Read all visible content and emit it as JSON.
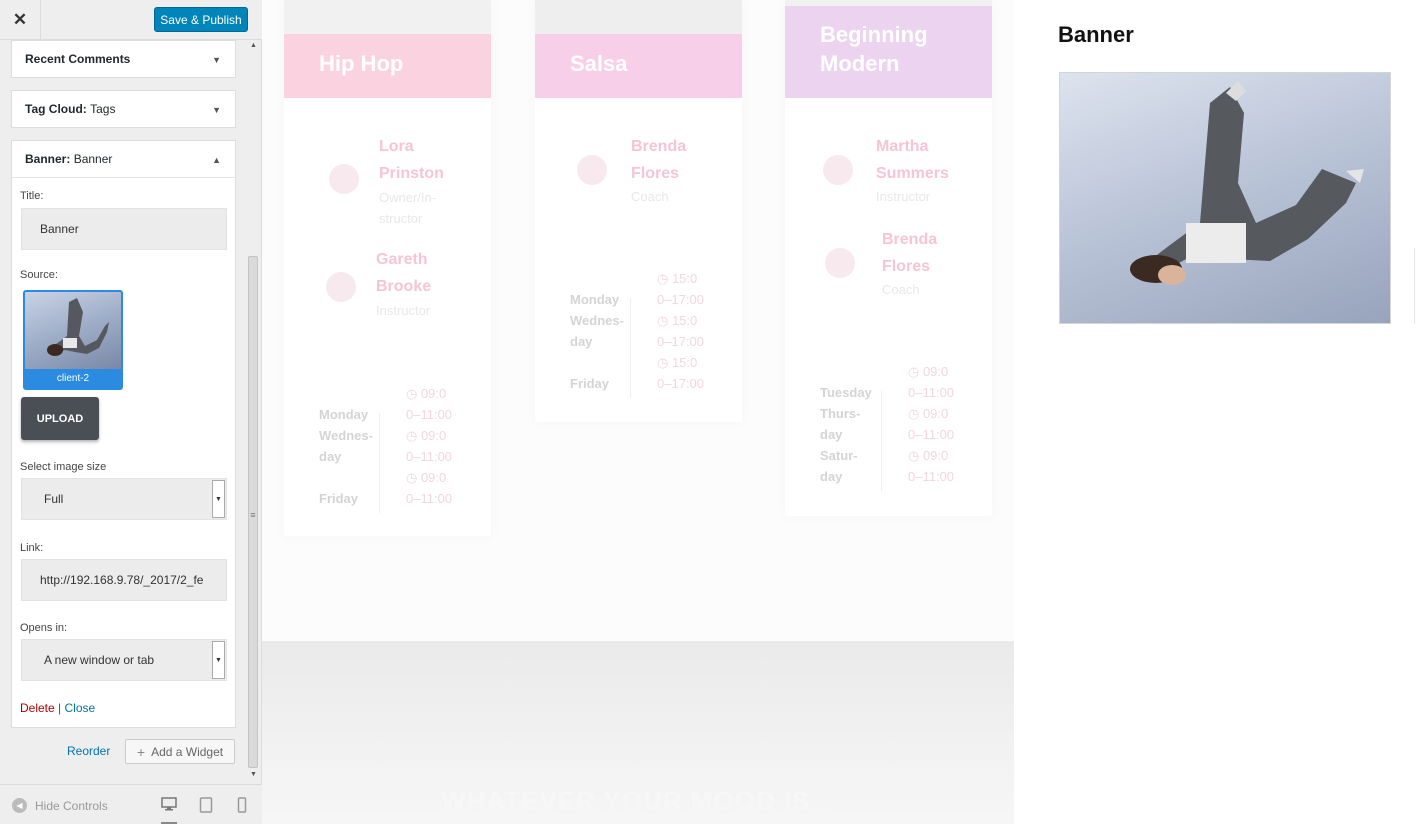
{
  "topbar": {
    "close_icon": "close-icon",
    "save_label": "Save & Publish"
  },
  "panels": {
    "recent_comments": "Recent Comments",
    "tag_cloud_name": "Tag Cloud:",
    "tag_cloud_title": "Tags",
    "banner_name": "Banner:",
    "banner_title": "Banner"
  },
  "widget": {
    "title_label": "Title:",
    "title_value": "Banner",
    "source_label": "Source:",
    "thumb_caption": "client-2",
    "upload_label": "UPLOAD",
    "size_label": "Select image size",
    "size_value": "Full",
    "link_label": "Link:",
    "link_value": "http://192.168.9.78/_2017/2_fe",
    "opens_label": "Opens in:",
    "opens_value": "A new window or tab",
    "delete_label": "Delete",
    "separator": "|",
    "close_label": "Close"
  },
  "footer": {
    "reorder_label": "Reorder",
    "add_widget_label": "Add a Widget",
    "hide_controls_label": "Hide Controls"
  },
  "preview": {
    "classes": [
      {
        "title_lines": [
          "Hip Hop"
        ],
        "instructors": [
          {
            "name_lines": [
              "Lora",
              "Prinston"
            ],
            "role_lines": [
              "Owner/In-",
              "structor"
            ]
          },
          {
            "name_lines": [
              "Gareth",
              "Brooke"
            ],
            "role_lines": [
              "Instructor"
            ]
          }
        ],
        "days": [
          "Monday",
          "Wednes-",
          "day",
          "",
          "Friday"
        ],
        "times": [
          "◷ 09:0",
          "0–11:00",
          "◷ 09:0",
          "0–11:00",
          "◷ 09:0",
          "0–11:00"
        ]
      },
      {
        "title_lines": [
          "Salsa"
        ],
        "instructors": [
          {
            "name_lines": [
              "Brenda",
              "Flores"
            ],
            "role_lines": [
              "Coach"
            ]
          }
        ],
        "days": [
          "Monday",
          "Wednes-",
          "day",
          "",
          "Friday"
        ],
        "times": [
          "◷ 15:0",
          "0–17:00",
          "◷ 15:0",
          "0–17:00",
          "◷ 15:0",
          "0–17:00"
        ]
      },
      {
        "title_lines": [
          "Beginning",
          "Modern"
        ],
        "instructors": [
          {
            "name_lines": [
              "Martha",
              "Summers"
            ],
            "role_lines": [
              "Instructor"
            ]
          },
          {
            "name_lines": [
              "Brenda",
              "Flores"
            ],
            "role_lines": [
              "Coach"
            ]
          }
        ],
        "days": [
          "Tuesday",
          "Thurs-",
          "day",
          "Satur-",
          "day"
        ],
        "times": [
          "◷ 09:0",
          "0–11:00",
          "◷ 09:0",
          "0–11:00",
          "◷ 09:0",
          "0–11:00"
        ]
      }
    ],
    "hero_text": "WHATEVER YOUR MOOD IS...",
    "banner_heading": "Banner"
  },
  "colors": {
    "accent": "#0085ba",
    "hiphop_head": "#fbd3e0",
    "salsa_head": "#f8cfe9",
    "modern_head": "#ecd3f0"
  }
}
